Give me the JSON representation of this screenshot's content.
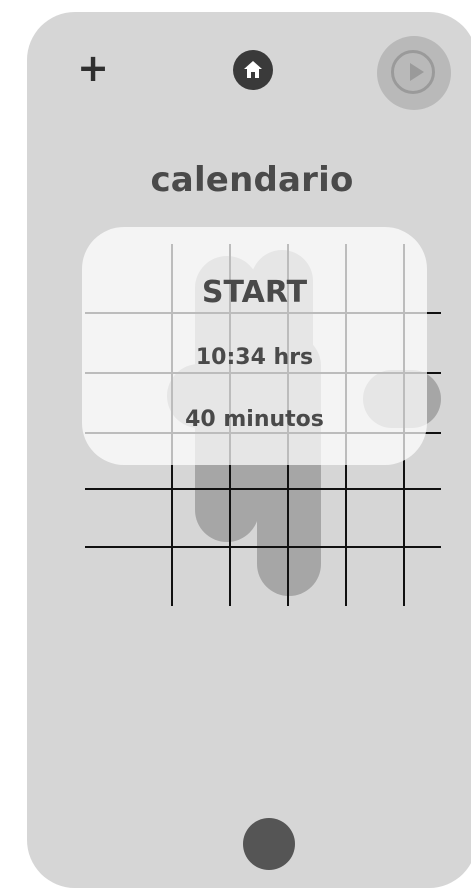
{
  "screen": {
    "title": "calendario"
  },
  "toolbar": {
    "add_icon": "plus-icon",
    "home_icon": "home-icon",
    "play_icon": "play-icon"
  },
  "card": {
    "label": "START",
    "time": "10:34 hrs",
    "duration": "40 minutos"
  },
  "colors": {
    "phone_bg": "#d6d6d6",
    "text": "#4a4a4a",
    "card_bg": "#ffffff",
    "dark": "#3a3a3a"
  }
}
